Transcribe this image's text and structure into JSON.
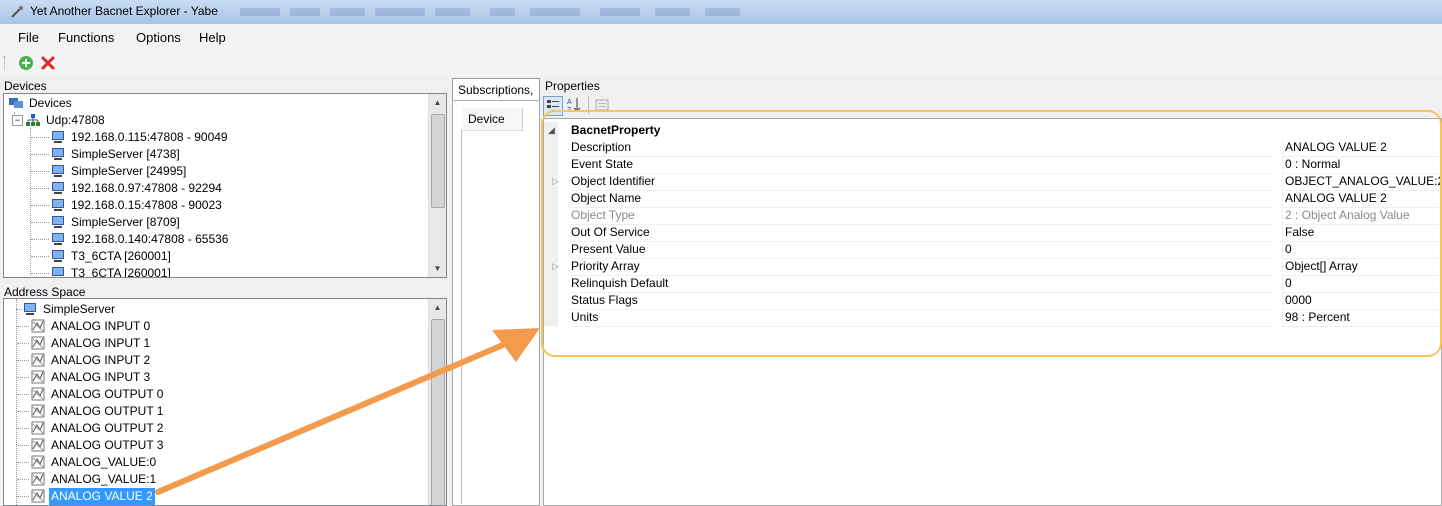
{
  "window": {
    "title": "Yet Another Bacnet Explorer - Yabe"
  },
  "menu": [
    "File",
    "Functions",
    "Options",
    "Help"
  ],
  "toolbar": {
    "add_icon": "add-icon",
    "delete_icon": "delete-icon"
  },
  "devices_panel": {
    "label": "Devices",
    "root": "Devices",
    "transport": "Udp:47808",
    "items": [
      "192.168.0.115:47808 - 90049",
      "SimpleServer [4738]",
      "SimpleServer [24995]",
      "192.168.0.97:47808 - 92294",
      "192.168.0.15:47808 - 90023",
      "SimpleServer [8709]",
      "192.168.0.140:47808 - 65536",
      "T3_6CTA [260001]",
      "T3_6CTA [260001]"
    ]
  },
  "address_space": {
    "label": "Address Space",
    "root": "SimpleServer",
    "items": [
      "ANALOG INPUT 0",
      "ANALOG INPUT 1",
      "ANALOG INPUT 2",
      "ANALOG INPUT 3",
      "ANALOG OUTPUT 0",
      "ANALOG OUTPUT 1",
      "ANALOG OUTPUT 2",
      "ANALOG OUTPUT 3",
      "ANALOG_VALUE:0",
      "ANALOG_VALUE:1",
      "ANALOG VALUE 2"
    ],
    "selected_index": 10
  },
  "middle": {
    "tab_label": "Subscriptions, ",
    "device_label": "Device"
  },
  "properties": {
    "label": "Properties",
    "category": "BacnetProperty",
    "rows": [
      {
        "name": "Description",
        "value": "ANALOG VALUE 2"
      },
      {
        "name": "Event State",
        "value": "0 : Normal"
      },
      {
        "name": "Object Identifier",
        "value": "OBJECT_ANALOG_VALUE:2",
        "expandable": true
      },
      {
        "name": "Object Name",
        "value": "ANALOG VALUE 2"
      },
      {
        "name": "Object Type",
        "value": "2 : Object Analog Value",
        "readonly": true
      },
      {
        "name": "Out Of Service",
        "value": "False"
      },
      {
        "name": "Present Value",
        "value": "0"
      },
      {
        "name": "Priority Array",
        "value": "Object[] Array",
        "expandable": true
      },
      {
        "name": "Relinquish Default",
        "value": "0"
      },
      {
        "name": "Status Flags",
        "value": "0000"
      },
      {
        "name": "Units",
        "value": "98 : Percent"
      }
    ]
  },
  "colors": {
    "selection": "#3399ff",
    "highlight": "#f5c65a",
    "arrow": "#f39a4c"
  }
}
